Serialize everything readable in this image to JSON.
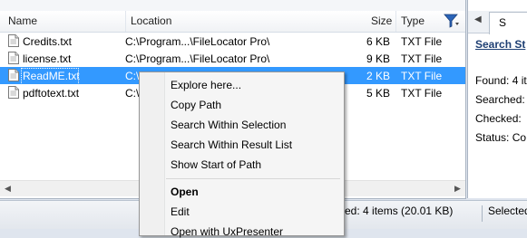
{
  "columns": {
    "name": "Name",
    "location": "Location",
    "size": "Size",
    "type": "Type"
  },
  "files": [
    {
      "name": "Credits.txt",
      "location": "C:\\Program...\\FileLocator Pro\\",
      "size": "6 KB",
      "type": "TXT File",
      "selected": false
    },
    {
      "name": "license.txt",
      "location": "C:\\Program...\\FileLocator Pro\\",
      "size": "9 KB",
      "type": "TXT File",
      "selected": false
    },
    {
      "name": "ReadME.txt",
      "location": "C:\\",
      "size": "2 KB",
      "type": "TXT File",
      "selected": true
    },
    {
      "name": "pdftotext.txt",
      "location": "C:\\",
      "size": "5 KB",
      "type": "TXT File",
      "selected": false
    }
  ],
  "right_panel": {
    "tab_label": "S",
    "heading": "Search St",
    "found": "Found: 4 it",
    "searched": "Searched:",
    "checked": "Checked:",
    "status": "Status: Co"
  },
  "statusbar": {
    "items_text": "ed: 4 items (20.01 KB)",
    "selected_text": "Selected"
  },
  "context_menu": {
    "items": [
      {
        "label": "Explore here...",
        "bold": false
      },
      {
        "label": "Copy Path",
        "bold": false
      },
      {
        "label": "Search Within Selection",
        "bold": false
      },
      {
        "label": "Search Within Result List",
        "bold": false
      },
      {
        "label": "Show Start of Path",
        "bold": false
      },
      {
        "label": "Open",
        "bold": true
      },
      {
        "label": "Edit",
        "bold": false
      },
      {
        "label": "Open with UxPresenter",
        "bold": false
      }
    ]
  },
  "icons": {
    "filter": "filter-icon",
    "file": "text-file-icon",
    "scroll_left": "scroll-left-icon",
    "scroll_right": "scroll-right-icon",
    "tab_left": "tab-scroll-left-icon"
  },
  "colors": {
    "selection": "#3399ff",
    "accent": "#2a64b8"
  }
}
